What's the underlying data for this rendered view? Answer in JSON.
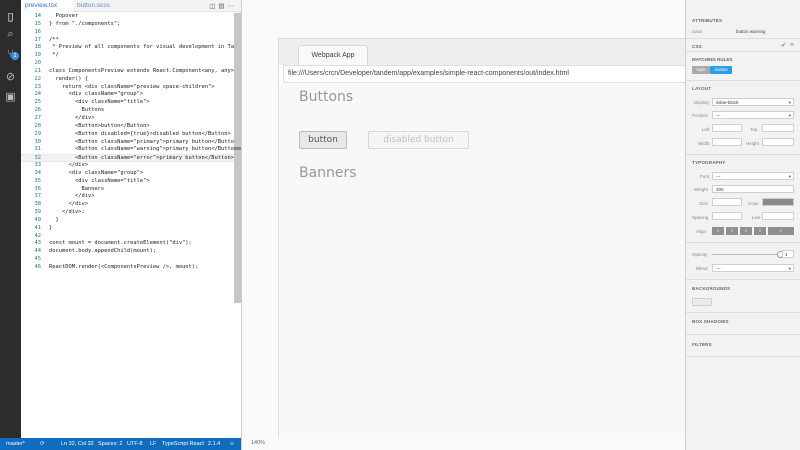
{
  "activity_bar": {
    "icons": [
      "files-icon",
      "search-icon",
      "git-icon",
      "debug-icon",
      "extensions-icon"
    ],
    "git_badge": "1"
  },
  "editor": {
    "tabs": [
      {
        "label": "preview.tsx"
      },
      {
        "label": "button.scss"
      }
    ],
    "lines": [
      {
        "n": "14",
        "t": "  Popover"
      },
      {
        "n": "15",
        "t": "} from \"./components\";"
      },
      {
        "n": "16",
        "t": ""
      },
      {
        "n": "17",
        "t": "/**"
      },
      {
        "n": "18",
        "t": " * Preview of all components for visual development in Tandem."
      },
      {
        "n": "19",
        "t": " */"
      },
      {
        "n": "20",
        "t": ""
      },
      {
        "n": "21",
        "t": "class ComponentsPreview extends React.Component<any, any> {"
      },
      {
        "n": "22",
        "t": "  render() {"
      },
      {
        "n": "23",
        "t": "    return <div className=\"preview space-children\">"
      },
      {
        "n": "24",
        "t": "      <div className=\"group\">"
      },
      {
        "n": "25",
        "t": "        <div className=\"title\">"
      },
      {
        "n": "26",
        "t": "          Buttons"
      },
      {
        "n": "27",
        "t": "        </div>"
      },
      {
        "n": "28",
        "t": "        <Button>button</Button>"
      },
      {
        "n": "29",
        "t": "        <Button disabled={true}>disabled button</Button>"
      },
      {
        "n": "30",
        "t": "        <Button className=\"primary\">primary button</Button>"
      },
      {
        "n": "31",
        "t": "        <Button className=\"warning\">primary button</Button>"
      },
      {
        "n": "32",
        "t": "        <Button className=\"error\">primary button</Button>"
      },
      {
        "n": "33",
        "t": "      </div>"
      },
      {
        "n": "34",
        "t": "      <div className=\"group\">"
      },
      {
        "n": "35",
        "t": "        <div className=\"title\">"
      },
      {
        "n": "36",
        "t": "          Banners"
      },
      {
        "n": "37",
        "t": "        </div>"
      },
      {
        "n": "38",
        "t": "      </div>"
      },
      {
        "n": "39",
        "t": "    </div>;"
      },
      {
        "n": "40",
        "t": "  }"
      },
      {
        "n": "41",
        "t": "}"
      },
      {
        "n": "42",
        "t": ""
      },
      {
        "n": "43",
        "t": "const mount = document.createElement(\"div\");"
      },
      {
        "n": "44",
        "t": "document.body.appendChild(mount);"
      },
      {
        "n": "45",
        "t": ""
      },
      {
        "n": "46",
        "t": "ReactDOM.render(<ComponentsPreview />, mount);"
      }
    ]
  },
  "status_bar": {
    "branch": "master*",
    "position": "Ln 32, Col 32",
    "spaces": "Spaces: 2",
    "encoding": "UTF-8",
    "eol": "LF",
    "language": "TypeScript React",
    "version": "2.1.4"
  },
  "preview": {
    "tab_label": "Webpack App",
    "url": "file:///Users/crcn/Developer/tandem/app/examples/simple-react-components/out/index.html",
    "title_buttons": "Buttons",
    "button_label": "button",
    "disabled_button_label": "disabled button",
    "title_banners": "Banners",
    "zoom": "140%"
  },
  "inspector": {
    "attributes_header": "ATTRIBUTES",
    "attr_key": "class",
    "attr_value": "button warning",
    "css_header": "CSS",
    "matching_rules_label": "MATCHING RULES",
    "rules": [
      "style",
      ".button"
    ],
    "layout_header": "LAYOUT",
    "display_label": "Display",
    "display_value": "inline-block",
    "position_label": "Position",
    "position_value": "---",
    "left_label": "Left",
    "top_label": "Top",
    "width_label": "Width",
    "height_label": "Height",
    "typography_header": "TYPOGRAPHY",
    "font_label": "Font",
    "font_value": "---",
    "weight_label": "Weight",
    "weight_value": "200",
    "size_label": "Size",
    "color_label": "Color",
    "spacing_label": "Spacing",
    "line_label": "Line",
    "align_label": "Align",
    "opacity_label": "Opacity",
    "opacity_value": "1",
    "opacity_level": 1,
    "blend_label": "Blend",
    "blend_value": "---",
    "backgrounds_header": "BACKGROUNDS",
    "box_shadows_header": "BOX SHADOWS",
    "filters_header": "FILTERS",
    "swatch_color": "#8a8a8a"
  }
}
